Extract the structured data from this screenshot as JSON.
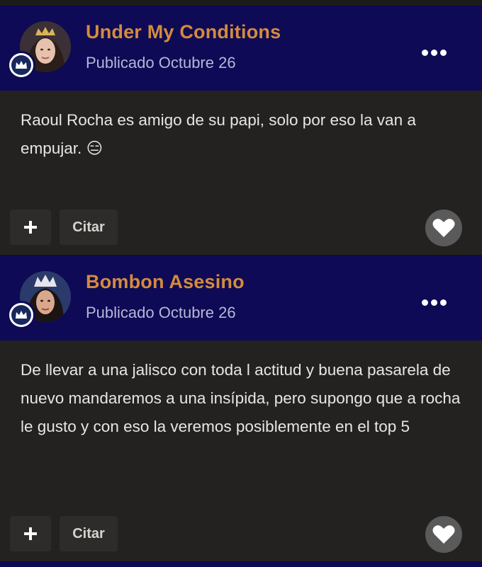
{
  "posts": [
    {
      "author": "Under My Conditions",
      "date": "Publicado Octubre 26",
      "text": "Raoul Rocha es amigo de su papi, solo por eso la van a empujar. ",
      "emoji": "😑",
      "quote_label": "Citar",
      "avatar_icon": "avatar-woman-crown",
      "badge_icon": "crown-icon"
    },
    {
      "author": "Bombon Asesino",
      "date": "Publicado Octubre 26",
      "text": "De llevar a una jalisco con toda l actitud y buena pasarela de nuevo mandaremos a una insípida, pero supongo que a rocha le gusto y con eso la veremos posiblemente en el top 5",
      "emoji": "",
      "quote_label": "Citar",
      "avatar_icon": "avatar-woman-crown",
      "badge_icon": "crown-icon"
    }
  ],
  "colors": {
    "header_bg": "#0e0a55",
    "author": "#d58b3d",
    "date": "#b8b6d6",
    "body_bg": "#242220",
    "body_text": "#e8e6e3",
    "like_bg": "#5a5a5a"
  }
}
